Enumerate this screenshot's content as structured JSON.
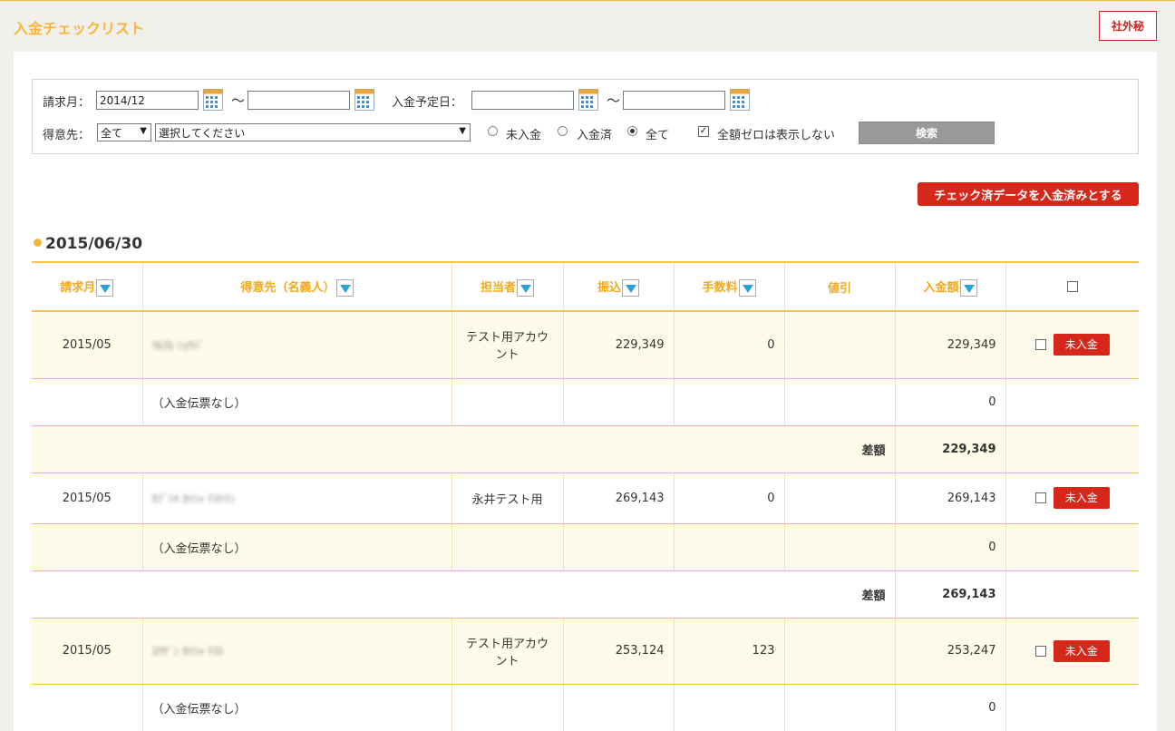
{
  "header": {
    "title": "入金チェックリスト",
    "confidential": "社外秘"
  },
  "filter": {
    "billing_month_label": "請求月：",
    "billing_month_from": "2014/12",
    "billing_month_to": "",
    "range_sep": "～",
    "payment_date_label": "入金予定日：",
    "payment_date_from": "",
    "payment_date_to": "",
    "customer_label": "得意先：",
    "customer_scope": "全て",
    "customer_select": "選択してください",
    "radio_unpaid": "未入金",
    "radio_paid": "入金済",
    "radio_all": "全て",
    "hide_zero_label": "全額ゼロは表示しない",
    "search_label": "検索"
  },
  "actions": {
    "mark_paid": "チェック済データを入金済みとする"
  },
  "group_date": "2015/06/30",
  "table": {
    "headers": [
      "請求月",
      "得意先（名義人）",
      "担当者",
      "振込",
      "手数料",
      "値引",
      "入金額"
    ],
    "unpaid_label": "未入金",
    "diff_label": "差額",
    "rows": [
      {
        "month": "2015/05",
        "customer": "ﾏﾙﾏﾙ ｼｮｳｼﾞ",
        "staff": "テスト用アカウント",
        "transfer": "229,349",
        "fee": "0",
        "discount": "",
        "amount": "229,349"
      },
      {
        "note": "（入金伝票なし）",
        "amount": "0"
      },
      {
        "diff": "229,349"
      },
      {
        "month": "2015/05",
        "customer": "ｶﾌﾞｼｷ ｶｲｼｬ  ﾃｽﾄﾃﾝ",
        "staff": "永井テスト用",
        "transfer": "269,143",
        "fee": "0",
        "discount": "",
        "amount": "269,143"
      },
      {
        "note": "（入金伝票なし）",
        "amount": "0"
      },
      {
        "diff": "269,143"
      },
      {
        "month": "2015/05",
        "customer": "ﾕｳｹﾞﾝ ｶｲｼｬ  ﾃｽﾄ",
        "staff": "テスト用アカウント",
        "transfer": "253,124",
        "fee": "123",
        "discount": "",
        "amount": "253,247"
      },
      {
        "note": "（入金伝票なし）",
        "amount": "0"
      }
    ]
  }
}
